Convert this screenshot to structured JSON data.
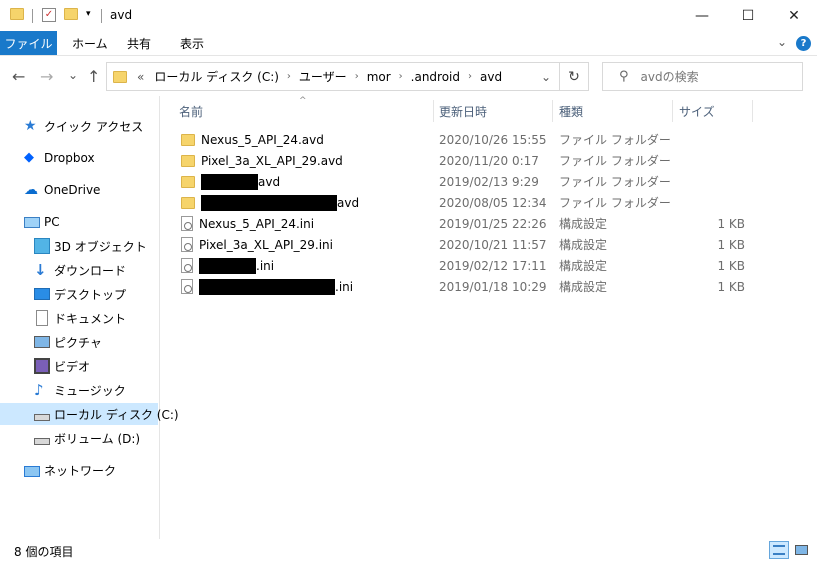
{
  "window": {
    "title": "avd",
    "minimize": "—",
    "maximize": "☐",
    "close": "✕"
  },
  "ribbon": {
    "tabs": [
      "ファイル",
      "ホーム",
      "共有",
      "表示"
    ],
    "collapse": "⌄",
    "help": "?"
  },
  "nav": {
    "back": "←",
    "forward": "→",
    "recent": "⌄",
    "up": "↑",
    "overflow": "«",
    "breadcrumb": [
      "ローカル ディスク (C:)",
      "ユーザー",
      "mor",
      ".android",
      "avd"
    ],
    "dropdown": "⌄",
    "refresh": "↻",
    "search_placeholder": "avdの検索"
  },
  "sidebar": {
    "items": [
      {
        "label": "クイック アクセス",
        "icon": "star-icon"
      },
      {
        "label": "Dropbox",
        "icon": "dropbox-icon"
      },
      {
        "label": "OneDrive",
        "icon": "cloud-icon"
      },
      {
        "label": "PC",
        "icon": "pc-icon"
      },
      {
        "label": "3D オブジェクト",
        "icon": "cube-icon"
      },
      {
        "label": "ダウンロード",
        "icon": "download-icon"
      },
      {
        "label": "デスクトップ",
        "icon": "desktop-icon"
      },
      {
        "label": "ドキュメント",
        "icon": "document-icon"
      },
      {
        "label": "ピクチャ",
        "icon": "picture-icon"
      },
      {
        "label": "ビデオ",
        "icon": "video-icon"
      },
      {
        "label": "ミュージック",
        "icon": "music-icon"
      },
      {
        "label": "ローカル ディスク (C:)",
        "icon": "drive-icon"
      },
      {
        "label": "ボリューム (D:)",
        "icon": "drive-icon"
      },
      {
        "label": "ネットワーク",
        "icon": "network-icon"
      }
    ]
  },
  "columns": {
    "name": "名前",
    "date": "更新日時",
    "type": "種類",
    "size": "サイズ"
  },
  "files": [
    {
      "name": "Nexus_5_API_24.avd",
      "date": "2020/10/26 15:55",
      "type": "ファイル フォルダー",
      "size": "",
      "kind": "folder"
    },
    {
      "name": "Pixel_3a_XL_API_29.avd",
      "date": "2020/11/20 0:17",
      "type": "ファイル フォルダー",
      "size": "",
      "kind": "folder"
    },
    {
      "name": "avd",
      "date": "2019/02/13 9:29",
      "type": "ファイル フォルダー",
      "size": "",
      "kind": "folder"
    },
    {
      "name": "avd",
      "date": "2020/08/05 12:34",
      "type": "ファイル フォルダー",
      "size": "",
      "kind": "folder"
    },
    {
      "name": "Nexus_5_API_24.ini",
      "date": "2019/01/25 22:26",
      "type": "構成設定",
      "size": "1 KB",
      "kind": "ini"
    },
    {
      "name": "Pixel_3a_XL_API_29.ini",
      "date": "2020/10/21 11:57",
      "type": "構成設定",
      "size": "1 KB",
      "kind": "ini"
    },
    {
      "name": ".ini",
      "date": "2019/02/12 17:11",
      "type": "構成設定",
      "size": "1 KB",
      "kind": "ini"
    },
    {
      "name": ".ini",
      "date": "2019/01/18 10:29",
      "type": "構成設定",
      "size": "1 KB",
      "kind": "ini"
    }
  ],
  "status": {
    "item_count": "8 個の項目"
  }
}
